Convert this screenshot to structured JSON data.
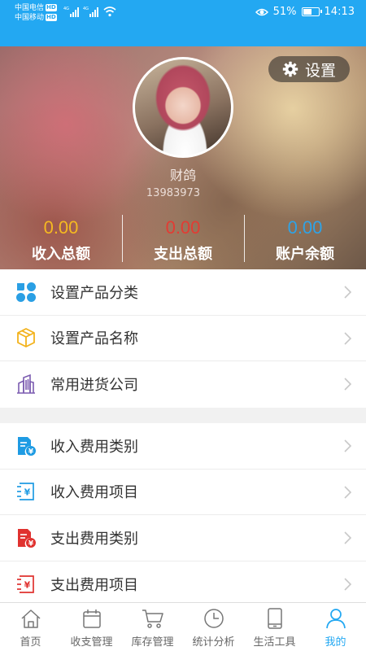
{
  "status_bar": {
    "carrier1": "中国电信",
    "carrier2": "中国移动",
    "hd": "HD",
    "battery": "51%",
    "time": "14:13"
  },
  "profile": {
    "settings_label": "设置",
    "username": "财鸽",
    "phone": "13983973",
    "stats": [
      {
        "value": "0.00",
        "label": "收入总额",
        "color": "#f5b921"
      },
      {
        "value": "0.00",
        "label": "支出总额",
        "color": "#e33b33"
      },
      {
        "value": "0.00",
        "label": "账户余额",
        "color": "#2fa3e6"
      }
    ]
  },
  "menu_group1": [
    {
      "label": "设置产品分类",
      "icon": "category-icon"
    },
    {
      "label": "设置产品名称",
      "icon": "box-icon"
    },
    {
      "label": "常用进货公司",
      "icon": "building-icon"
    }
  ],
  "menu_group2": [
    {
      "label": "收入费用类别",
      "icon": "income-category-icon"
    },
    {
      "label": "收入费用项目",
      "icon": "income-item-icon"
    },
    {
      "label": "支出费用类别",
      "icon": "expense-category-icon"
    },
    {
      "label": "支出费用项目",
      "icon": "expense-item-icon"
    }
  ],
  "tabs": [
    {
      "label": "首页",
      "icon": "home-icon"
    },
    {
      "label": "收支管理",
      "icon": "calendar-icon"
    },
    {
      "label": "库存管理",
      "icon": "cart-icon"
    },
    {
      "label": "统计分析",
      "icon": "clock-icon"
    },
    {
      "label": "生活工具",
      "icon": "phone-icon"
    },
    {
      "label": "我的",
      "icon": "person-icon",
      "active": true
    }
  ],
  "colors": {
    "accent": "#23a8f2"
  }
}
